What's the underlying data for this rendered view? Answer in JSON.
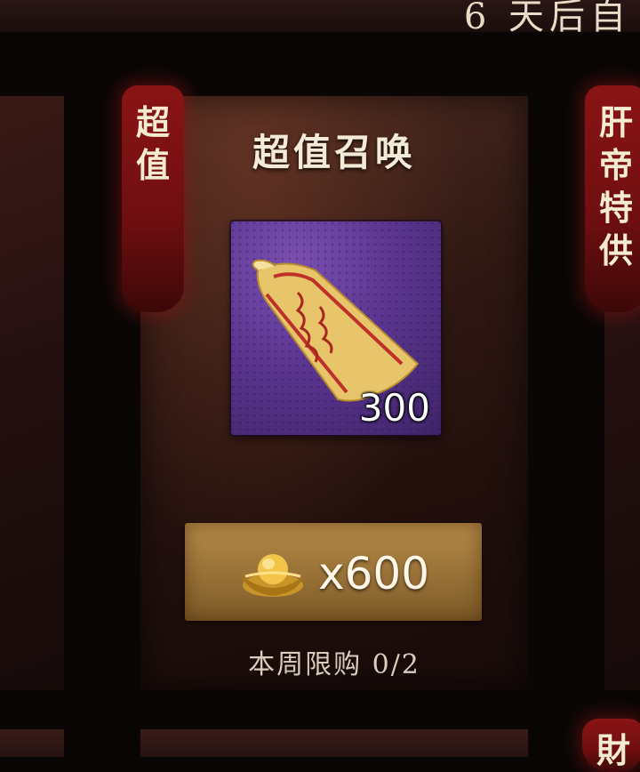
{
  "header": {
    "countdown_text": "6 天后自"
  },
  "card": {
    "tag": "超值",
    "title": "超值召唤",
    "item": {
      "name_icon": "summon-scroll-icon",
      "count": "300"
    },
    "price": {
      "currency_icon": "gold-ingot-icon",
      "label": "x600"
    },
    "limit": "本周限购  0/2"
  },
  "neighbor_card": {
    "tag": "肝帝特供"
  },
  "bottom_card": {
    "tag": "財"
  },
  "colors": {
    "ribbon": "#7a1010",
    "button": "#a07a3c",
    "item_bg": "#5b3590"
  }
}
